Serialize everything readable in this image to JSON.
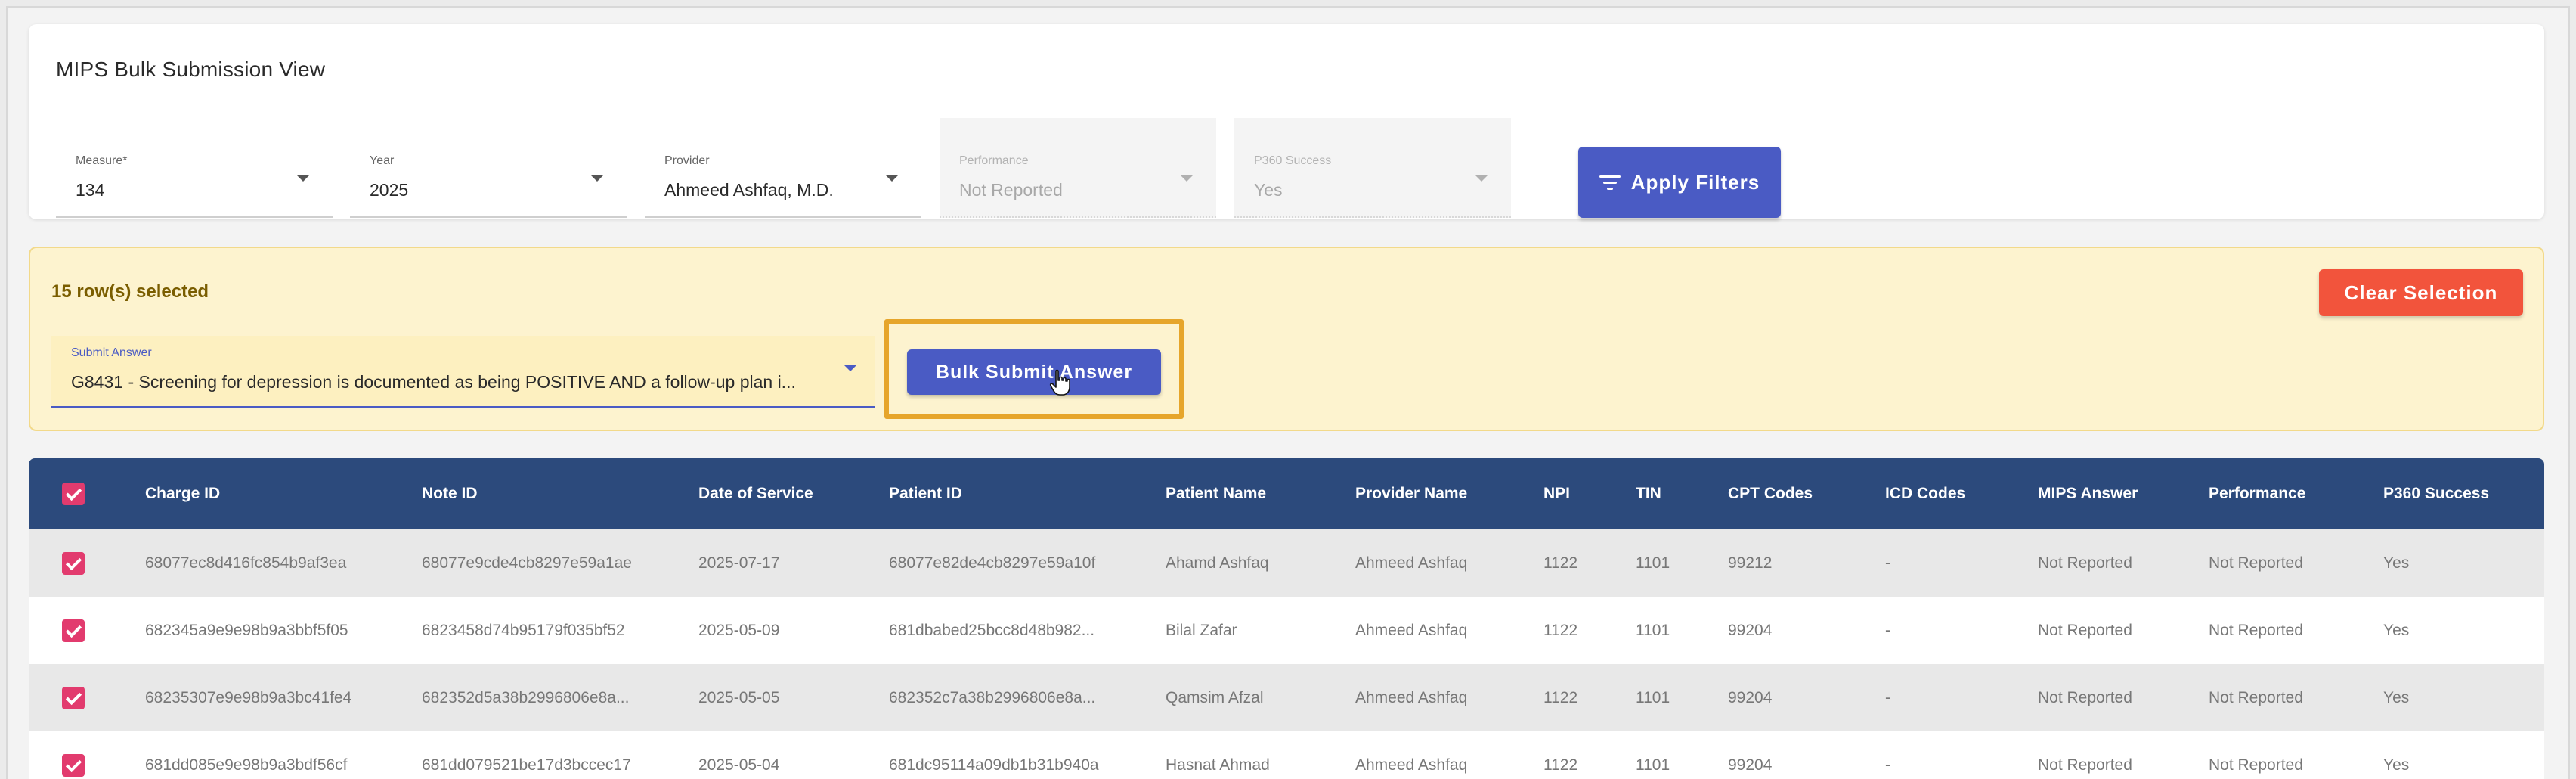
{
  "page_title": "MIPS Bulk Submission View",
  "filters": [
    {
      "label": "Measure*",
      "value": "134",
      "disabled": false
    },
    {
      "label": "Year",
      "value": "2025",
      "disabled": false
    },
    {
      "label": "Provider",
      "value": "Ahmeed Ashfaq, M.D.",
      "disabled": false
    },
    {
      "label": "Performance",
      "value": "Not Reported",
      "disabled": true
    },
    {
      "label": "P360 Success",
      "value": "Yes",
      "disabled": true
    }
  ],
  "apply_filters_label": "Apply Filters",
  "selection": {
    "count_text": "15 row(s) selected",
    "clear_label": "Clear Selection",
    "submit_answer_label": "Submit Answer",
    "submit_answer_value": "G8431 - Screening for depression is documented as being POSITIVE AND a follow-up plan i...",
    "bulk_submit_label": "Bulk Submit Answer"
  },
  "table": {
    "columns": [
      "Charge ID",
      "Note ID",
      "Date of Service",
      "Patient ID",
      "Patient Name",
      "Provider Name",
      "NPI",
      "TIN",
      "CPT Codes",
      "ICD Codes",
      "MIPS Answer",
      "Performance",
      "P360 Success"
    ],
    "rows": [
      [
        "68077ec8d416fc854b9af3ea",
        "68077e9cde4cb8297e59a1ae",
        "2025-07-17",
        "68077e82de4cb8297e59a10f",
        "Ahamd Ashfaq",
        "Ahmeed Ashfaq",
        "1122",
        "1101",
        "99212",
        "-",
        "Not Reported",
        "Not Reported",
        "Yes"
      ],
      [
        "682345a9e9e98b9a3bbf5f05",
        "6823458d74b95179f035bf52",
        "2025-05-09",
        "681dbabed25bcc8d48b982...",
        "Bilal Zafar",
        "Ahmeed Ashfaq",
        "1122",
        "1101",
        "99204",
        "-",
        "Not Reported",
        "Not Reported",
        "Yes"
      ],
      [
        "68235307e9e98b9a3bc41fe4",
        "682352d5a38b2996806e8a...",
        "2025-05-05",
        "682352c7a38b2996806e8a...",
        "Qamsim Afzal",
        "Ahmeed Ashfaq",
        "1122",
        "1101",
        "99204",
        "-",
        "Not Reported",
        "Not Reported",
        "Yes"
      ],
      [
        "681dd085e9e98b9a3bdf56cf",
        "681dd079521be17d3bccec17",
        "2025-05-04",
        "681dc95114a09db1b31b940a",
        "Hasnat Ahmad",
        "Ahmeed Ashfaq",
        "1122",
        "1101",
        "99204",
        "-",
        "Not Reported",
        "Not Reported",
        "Yes"
      ]
    ]
  },
  "colors": {
    "primary": "#4a5bc4",
    "danger": "#f2543c",
    "header_bg": "#2c4a7c",
    "checkbox": "#e23b6e",
    "banner_bg": "#fdf3cf",
    "highlight": "#e6a52b"
  },
  "icons": {
    "apply_filters": "filter-icon",
    "select_caret": "chevron-down-icon",
    "cursor": "hand-pointer-icon",
    "checkbox": "checkbox-checked-icon"
  }
}
